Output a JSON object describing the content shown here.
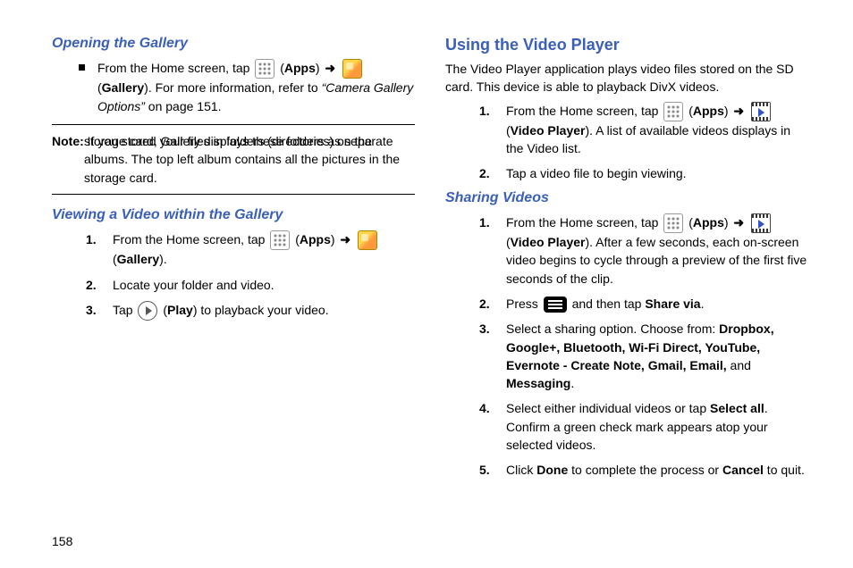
{
  "pageNumber": "158",
  "left": {
    "h1": "Opening the Gallery",
    "bullet1_a": "From the Home screen, tap ",
    "bullet1_apps": "Apps",
    "bullet1_b": " (",
    "bullet1_gallery": "Gallery",
    "bullet1_c": "). For more information, refer to ",
    "bullet1_ref": "“Camera Gallery Options”",
    "bullet1_d": "  on page 151.",
    "note_label": "Note:",
    "note_first": " If you stored your files in folders (directories) on the",
    "note_rest": "storage card, Gallery displays these folders as separate albums. The top left album contains all the pictures in the storage card.",
    "h2": "Viewing a Video within the Gallery",
    "steps": {
      "s1_a": "From the Home screen, tap ",
      "s1_apps": "Apps",
      "s1_b": " (",
      "s1_gallery": "Gallery",
      "s1_c": ").",
      "s2": "Locate your folder and video.",
      "s3_a": "Tap ",
      "s3_play": "Play",
      "s3_b": ") to playback your video."
    },
    "nums": {
      "n1": "1.",
      "n2": "2.",
      "n3": "3."
    }
  },
  "right": {
    "h1": "Using the Video Player",
    "intro": "The Video Player application plays video files stored on the SD card. This device is able to playback DivX videos.",
    "s1_a": "From the Home screen, tap ",
    "s1_apps": "Apps",
    "s1_b": "(",
    "s1_vp": "Video Player",
    "s1_c": "). A list of available videos displays in the Video list.",
    "s2": "Tap a video file to begin viewing.",
    "h2": "Sharing Videos",
    "sv1_a": "From the Home screen, tap ",
    "sv1_apps": "Apps",
    "sv1_b": "(",
    "sv1_vp": "Video Player",
    "sv1_c": "). After a few seconds, each on-screen video begins to cycle through a preview of the first five seconds of the clip.",
    "sv2_a": "Press ",
    "sv2_b": " and then tap ",
    "sv2_share": "Share via",
    "sv2_c": ".",
    "sv3_a": "Select a sharing option. Choose from: ",
    "sv3_opts": "Dropbox, Google+, Bluetooth, Wi-Fi Direct, YouTube, Evernote - Create Note, Gmail, Email, ",
    "sv3_and": "and ",
    "sv3_last": "Messaging",
    "sv3_d": ".",
    "sv4_a": "Select either individual videos or tap ",
    "sv4_sel": "Select all",
    "sv4_b": ". Confirm a green check mark appears atop your selected videos.",
    "sv5_a": "Click ",
    "sv5_done": "Done",
    "sv5_b": " to complete the process or ",
    "sv5_cancel": "Cancel",
    "sv5_c": " to quit.",
    "nums": {
      "n1": "1.",
      "n2": "2.",
      "n3": "3.",
      "n4": "4.",
      "n5": "5."
    }
  },
  "glyphs": {
    "arrow": "➜",
    "openParen": " ("
  }
}
